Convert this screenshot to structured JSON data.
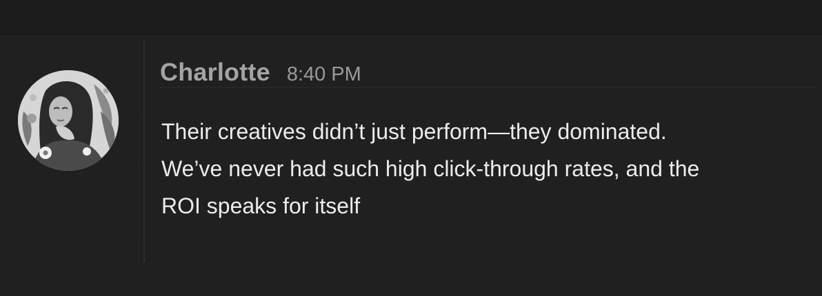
{
  "message": {
    "author": "Charlotte",
    "time": "8:40 PM",
    "lines": [
      "Their creatives didn’t just perform—they dominated.",
      "We’ve never had such high click-through rates, and the",
      "ROI speaks for itself"
    ]
  },
  "colors": {
    "background": "#202020",
    "author": "#a4a4a4",
    "timestamp": "#9a9a9a",
    "text": "#ececec"
  },
  "icons": {
    "avatar": "user-avatar-photo"
  }
}
